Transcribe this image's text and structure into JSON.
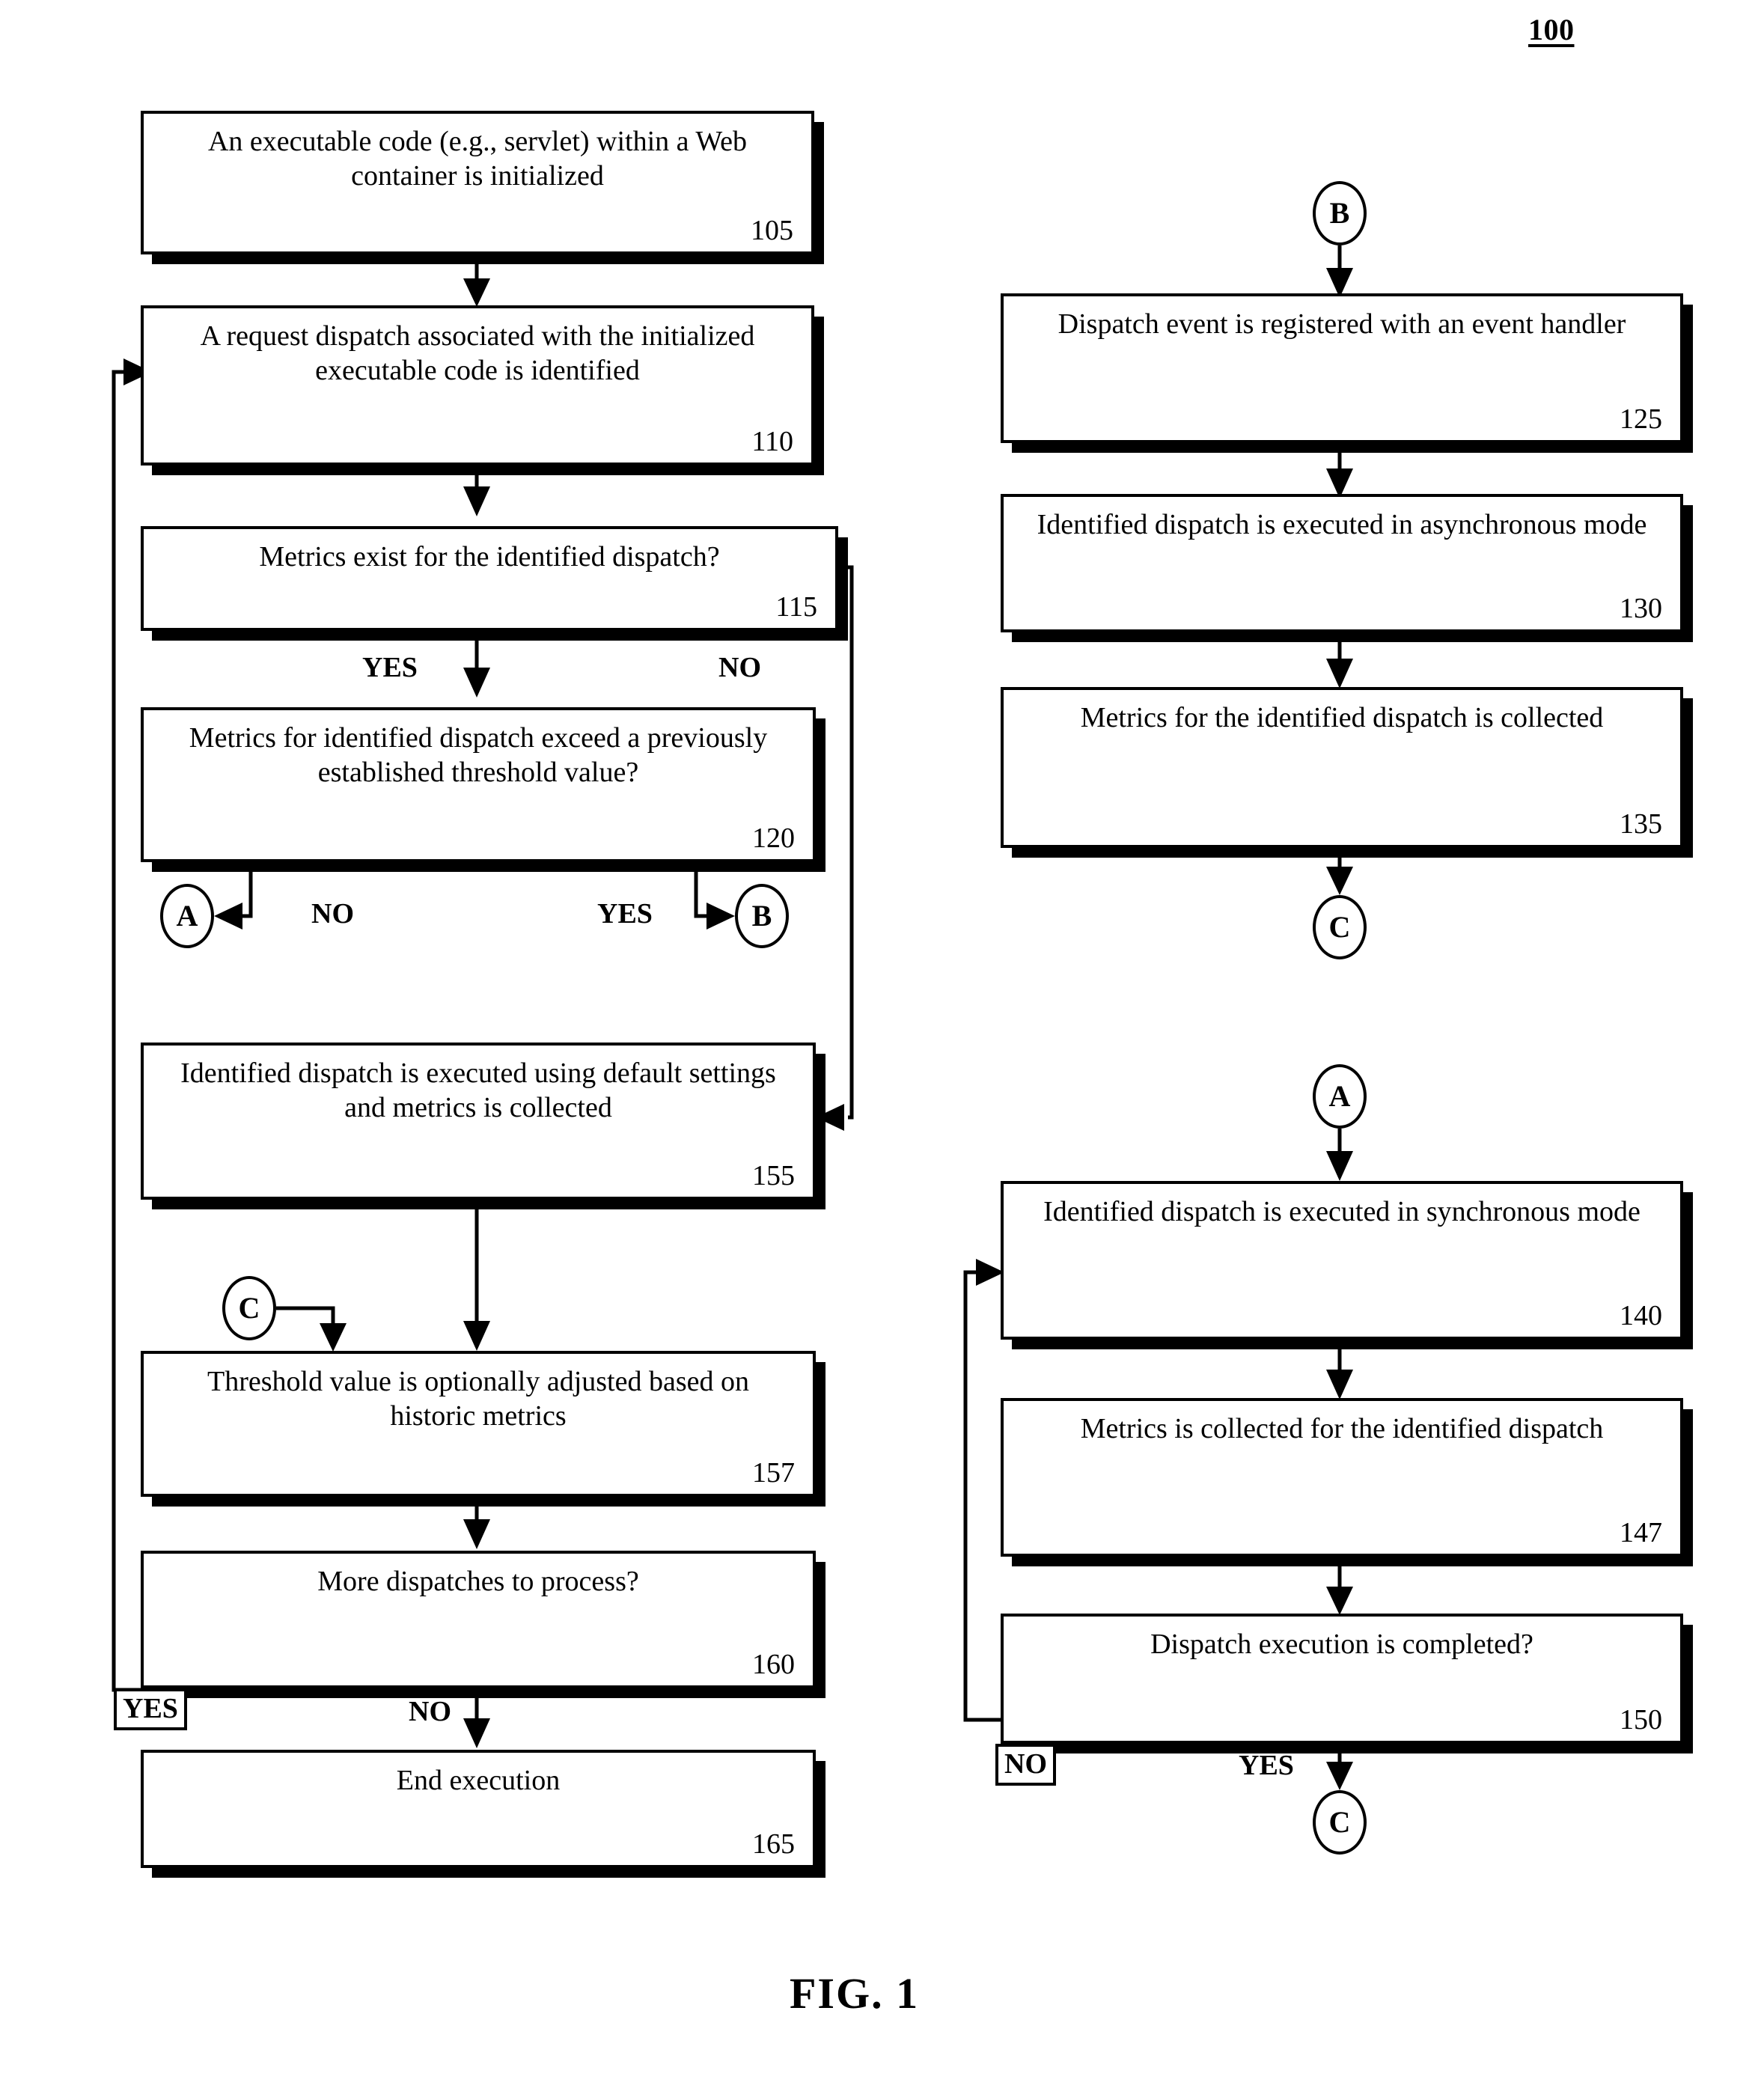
{
  "figure": {
    "number": "100",
    "caption": "FIG. 1"
  },
  "nodes": [
    {
      "id": "105",
      "text": "An executable code (e.g., servlet) within a Web container is initialized",
      "num": "105"
    },
    {
      "id": "110",
      "text": "A request dispatch associated with the initialized executable code is identified",
      "num": "110"
    },
    {
      "id": "115",
      "text": "Metrics exist for the identified dispatch?",
      "num": "115"
    },
    {
      "id": "120",
      "text": "Metrics for identified dispatch exceed a previously established threshold value?",
      "num": "120"
    },
    {
      "id": "155",
      "text": "Identified dispatch is executed using default settings and metrics is collected",
      "num": "155"
    },
    {
      "id": "157",
      "text": "Threshold value is optionally adjusted based on historic metrics",
      "num": "157"
    },
    {
      "id": "160",
      "text": "More dispatches to process?",
      "num": "160"
    },
    {
      "id": "165",
      "text": "End execution",
      "num": "165"
    },
    {
      "id": "125",
      "text": "Dispatch event is registered with an event handler",
      "num": "125"
    },
    {
      "id": "130",
      "text": "Identified dispatch is executed in asynchronous mode",
      "num": "130"
    },
    {
      "id": "135",
      "text": "Metrics for the identified dispatch is collected",
      "num": "135"
    },
    {
      "id": "140",
      "text": "Identified dispatch is executed in synchronous mode",
      "num": "140"
    },
    {
      "id": "147",
      "text": "Metrics is collected for the identified dispatch",
      "num": "147"
    },
    {
      "id": "150",
      "text": "Dispatch execution is completed?",
      "num": "150"
    }
  ],
  "connectors": [
    {
      "id": "b-top-right",
      "label": "B"
    },
    {
      "id": "a-from-120",
      "label": "A"
    },
    {
      "id": "b-from-120",
      "label": "B"
    },
    {
      "id": "c-into-157",
      "label": "C"
    },
    {
      "id": "c-from-135",
      "label": "C"
    },
    {
      "id": "a-into-140",
      "label": "A"
    },
    {
      "id": "c-from-150",
      "label": "C"
    }
  ],
  "edge_labels": [
    {
      "id": "115-yes",
      "text": "YES"
    },
    {
      "id": "115-no",
      "text": "NO"
    },
    {
      "id": "120-no",
      "text": "NO"
    },
    {
      "id": "120-yes",
      "text": "YES"
    },
    {
      "id": "160-yes",
      "text": "YES"
    },
    {
      "id": "160-no",
      "text": "NO"
    },
    {
      "id": "150-no",
      "text": "NO"
    },
    {
      "id": "150-yes",
      "text": "YES"
    }
  ]
}
